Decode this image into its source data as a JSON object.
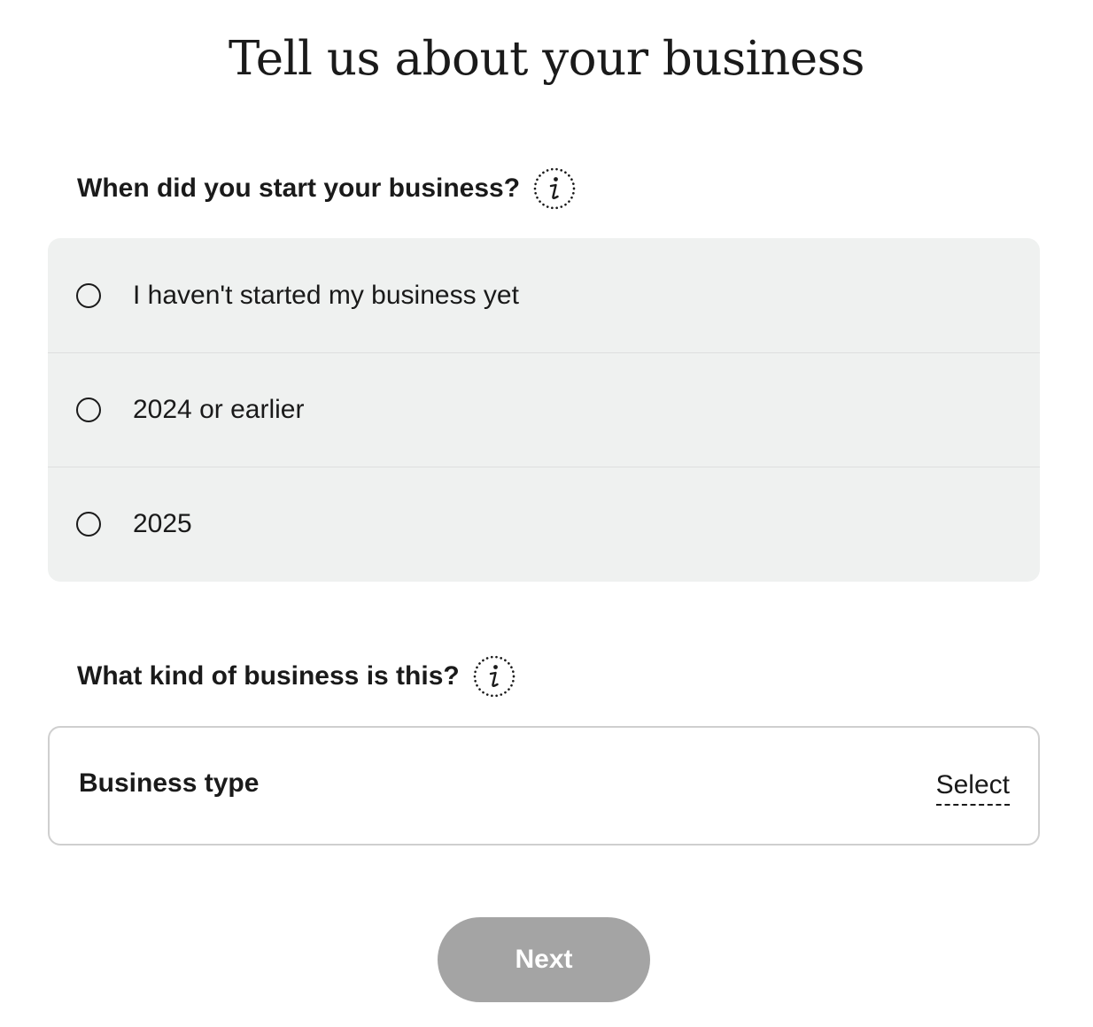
{
  "page": {
    "title": "Tell us about your business"
  },
  "start_question": {
    "label": "When did you start your business?",
    "info_icon": "info-icon",
    "options": [
      {
        "label": "I haven't started my business yet",
        "selected": false
      },
      {
        "label": "2024 or earlier",
        "selected": false
      },
      {
        "label": "2025",
        "selected": false
      }
    ]
  },
  "kind_question": {
    "label": "What kind of business is this?",
    "info_icon": "info-icon",
    "field": {
      "label": "Business type",
      "action": "Select"
    }
  },
  "footer": {
    "next_label": "Next"
  },
  "colors": {
    "option_background": "#eff1f0",
    "next_button_disabled": "#a4a4a4",
    "text": "#1a1a1a",
    "field_border": "#cfcfcf"
  }
}
